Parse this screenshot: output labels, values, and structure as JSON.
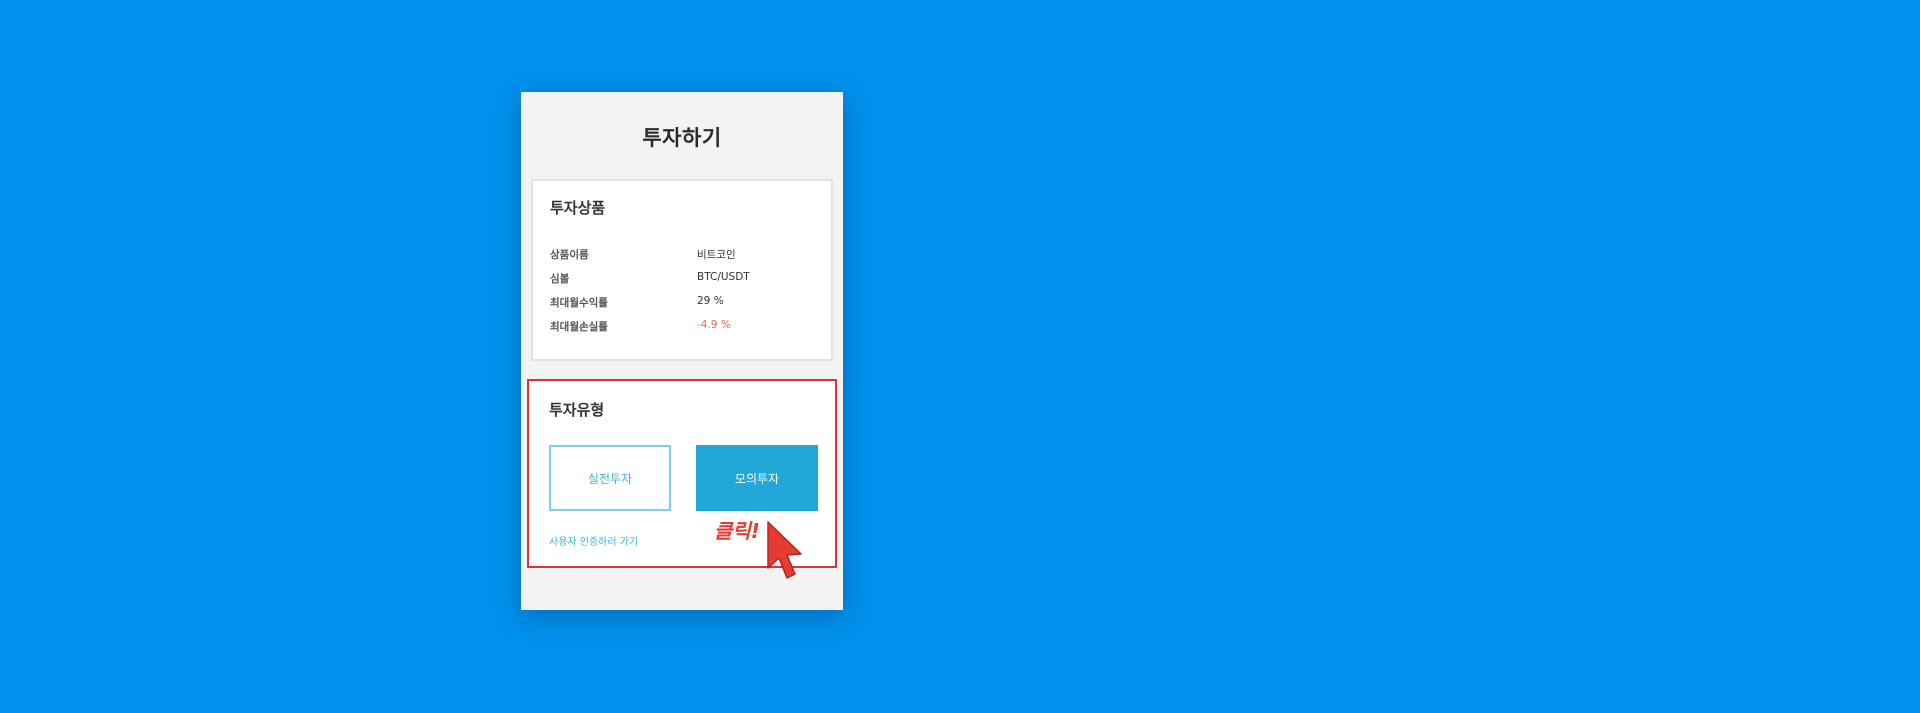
{
  "page": {
    "title": "투자하기",
    "background_color": "#0091EC"
  },
  "product": {
    "section_title": "투자상품",
    "rows": [
      {
        "label": "상품이름",
        "value": "비트코인"
      },
      {
        "label": "심볼",
        "value": "BTC/USDT"
      },
      {
        "label": "최대월수익률",
        "value": "29 %"
      },
      {
        "label": "최대월손실률",
        "value": "-4.9 %"
      }
    ]
  },
  "invest_type": {
    "section_title": "투자유형",
    "real_button": "실전투자",
    "mock_button": "모의투자",
    "verify_link": "사용자 인증하러 가기",
    "highlight_color": "#D8353A",
    "accent_color": "#21A8D8"
  },
  "annotation": {
    "click_label": "클릭!",
    "cursor_icon": "cursor-arrow-icon",
    "color": "#E53B30"
  }
}
